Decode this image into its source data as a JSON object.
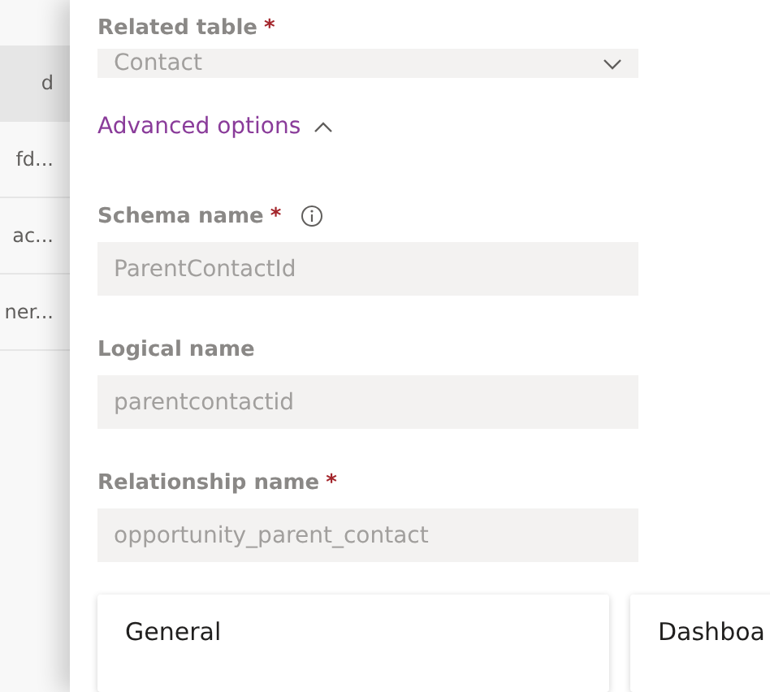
{
  "background_list": {
    "items": [
      {
        "label": "d",
        "selected": true
      },
      {
        "label": "fd...",
        "selected": false
      },
      {
        "label": "ac...",
        "selected": false
      },
      {
        "label": "ner...",
        "selected": false
      }
    ]
  },
  "panel": {
    "related_table": {
      "label": "Related table",
      "required_mark": "*",
      "kind": "dropdown",
      "value": "Contact",
      "disabled": true
    },
    "advanced_options": {
      "label": "Advanced options",
      "expanded": true
    },
    "fields": [
      {
        "label": "Schema name",
        "required_mark": "*",
        "info": true,
        "value": "ParentContactId",
        "disabled": true
      },
      {
        "label": "Logical name",
        "info": false,
        "value": "parentcontactid",
        "disabled": true
      },
      {
        "label": "Relationship name",
        "required_mark": "*",
        "info": false,
        "value": "opportunity_parent_contact",
        "disabled": true
      }
    ],
    "cards": [
      {
        "title": "General"
      },
      {
        "title": "Dashboa"
      }
    ]
  }
}
